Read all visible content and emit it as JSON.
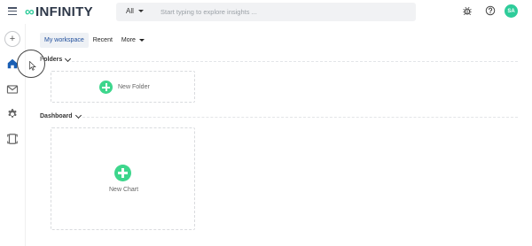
{
  "app": {
    "logo_text": "INFINITY",
    "logo_mark": "∞"
  },
  "search": {
    "scope_value": "All",
    "placeholder": "Start typing to explore insights ..."
  },
  "header_icons": [
    "bug-icon",
    "help-icon"
  ],
  "user": {
    "initials": "SA",
    "avatar_color": "#2ecc9a"
  },
  "rail": {
    "add_label": "+",
    "items": [
      "home-icon",
      "mail-icon",
      "gear-icon",
      "expand-icon"
    ]
  },
  "tabs": [
    {
      "label": "My workspace",
      "active": true
    },
    {
      "label": "Recent",
      "active": false
    },
    {
      "label": "More",
      "active": false
    }
  ],
  "sections": {
    "folders": {
      "title": "Folders",
      "new_label": "New Folder"
    },
    "dashboard": {
      "title": "Dashboard",
      "new_label": "New Chart"
    }
  },
  "colors": {
    "accent_green": "#3dd68c",
    "active_tab_text": "#1f4e9c"
  }
}
